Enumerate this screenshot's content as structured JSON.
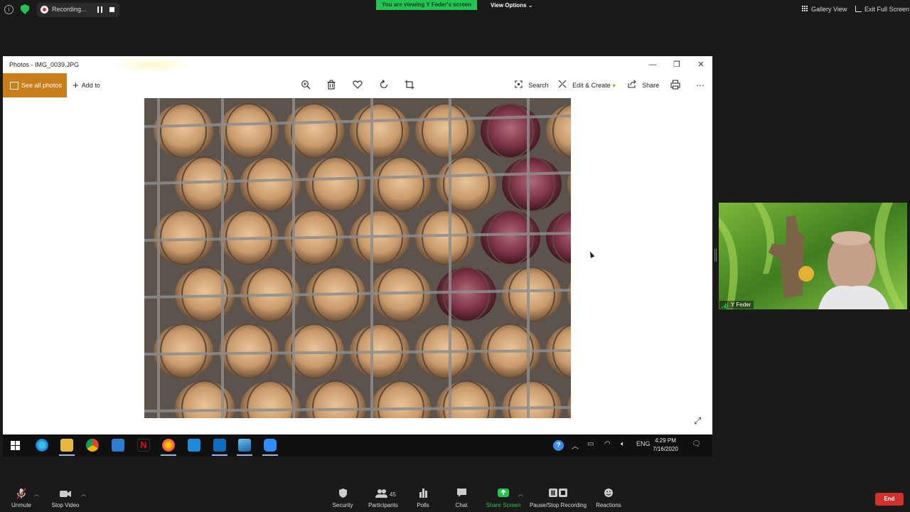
{
  "zoom_top": {
    "recording_label": "Recording...",
    "viewing_banner": "You are viewing Y Feder's screen",
    "view_options": "View Options",
    "gallery_view": "Gallery View",
    "exit_full_screen": "Exit Full Screen"
  },
  "photos_app": {
    "window_title": "Photos - IMG_0039.JPG",
    "see_all_photos": "See all photos",
    "add_to": "Add to",
    "search": "Search",
    "edit_create": "Edit & Create",
    "share": "Share",
    "accent_color": "#c97d1b"
  },
  "taskbar": {
    "language": "ENG",
    "time": "4:29 PM",
    "date": "7/16/2020"
  },
  "participant": {
    "name": "Y Feder"
  },
  "zoom_bottom": {
    "unmute": "Unmute",
    "stop_video": "Stop Video",
    "security": "Security",
    "participants": "Participants",
    "participants_count": "45",
    "polls": "Polls",
    "chat": "Chat",
    "share_screen": "Share Screen",
    "pause_stop_recording": "Pause/Stop Recording",
    "reactions": "Reactions",
    "end": "End",
    "end_color": "#d0312d",
    "share_color": "#23c552"
  }
}
